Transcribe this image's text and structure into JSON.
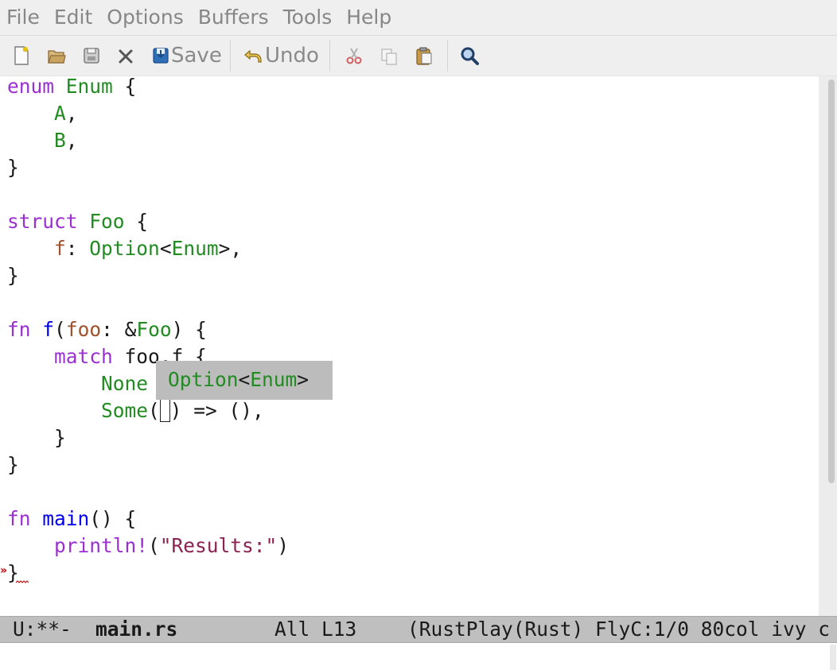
{
  "menubar": {
    "items": [
      "File",
      "Edit",
      "Options",
      "Buffers",
      "Tools",
      "Help"
    ]
  },
  "toolbar": {
    "new_file_icon": "new-file-icon",
    "open_icon": "folder-open-icon",
    "dired_icon": "directory-icon",
    "close_icon": "close-icon",
    "save_icon": "floppy-disk-icon",
    "save_label": "Save",
    "undo_icon": "undo-arrow-icon",
    "undo_label": "Undo",
    "cut_icon": "scissors-icon",
    "copy_icon": "copy-icon",
    "paste_icon": "clipboard-icon",
    "search_icon": "magnifier-icon"
  },
  "editor": {
    "language": "Rust",
    "lines": [
      [
        {
          "t": "enum",
          "c": "kw"
        },
        {
          "t": " "
        },
        {
          "t": "Enum",
          "c": "ty"
        },
        {
          "t": " {"
        }
      ],
      [
        {
          "t": "    "
        },
        {
          "t": "A",
          "c": "ty"
        },
        {
          "t": ","
        }
      ],
      [
        {
          "t": "    "
        },
        {
          "t": "B",
          "c": "ty"
        },
        {
          "t": ","
        }
      ],
      [
        {
          "t": "}"
        }
      ],
      [],
      [
        {
          "t": "struct",
          "c": "kw"
        },
        {
          "t": " "
        },
        {
          "t": "Foo",
          "c": "ty"
        },
        {
          "t": " {"
        }
      ],
      [
        {
          "t": "    "
        },
        {
          "t": "f",
          "c": "var"
        },
        {
          "t": ": "
        },
        {
          "t": "Option",
          "c": "ty"
        },
        {
          "t": "<"
        },
        {
          "t": "Enum",
          "c": "ty"
        },
        {
          "t": ">,"
        }
      ],
      [
        {
          "t": "}"
        }
      ],
      [],
      [
        {
          "t": "fn",
          "c": "kw"
        },
        {
          "t": " "
        },
        {
          "t": "f",
          "c": "fn"
        },
        {
          "t": "("
        },
        {
          "t": "foo",
          "c": "var"
        },
        {
          "t": ": &"
        },
        {
          "t": "Foo",
          "c": "ty"
        },
        {
          "t": ") {"
        }
      ],
      [
        {
          "t": "    "
        },
        {
          "t": "match",
          "c": "kw"
        },
        {
          "t": " foo.f {"
        }
      ],
      [
        {
          "t": "        "
        },
        {
          "t": "None",
          "c": "ty"
        },
        {
          "t": " => (),"
        }
      ],
      [
        {
          "t": "        "
        },
        {
          "t": "Some",
          "c": "ty"
        },
        {
          "t": "("
        },
        {
          "cursor": true
        },
        {
          "t": ") => (),"
        }
      ],
      [
        {
          "t": "    }"
        }
      ],
      [
        {
          "t": "}"
        }
      ],
      [],
      [
        {
          "t": "fn",
          "c": "kw"
        },
        {
          "t": " "
        },
        {
          "t": "main",
          "c": "fn"
        },
        {
          "t": "() {"
        }
      ],
      [
        {
          "t": "    "
        },
        {
          "t": "println!",
          "c": "kw"
        },
        {
          "t": "("
        },
        {
          "t": "\"Results:\"",
          "c": "str"
        },
        {
          "t": ")"
        }
      ],
      [
        {
          "t": "}"
        }
      ]
    ],
    "type_popup": {
      "base": "Option",
      "open": "<",
      "arg": "Enum",
      "close": ">"
    },
    "fringe_marker": "»"
  },
  "modeline": {
    "status": "U:**-",
    "buffer": "main.rs",
    "position": "All L13",
    "modes": "(RustPlay(Rust) FlyC:1/0 80col ivy c"
  },
  "colors": {
    "keyword": "#9b30d0",
    "type": "#228b22",
    "function": "#0000ee",
    "variable": "#a0522d",
    "string": "#8b2252",
    "error": "#cc0000"
  }
}
